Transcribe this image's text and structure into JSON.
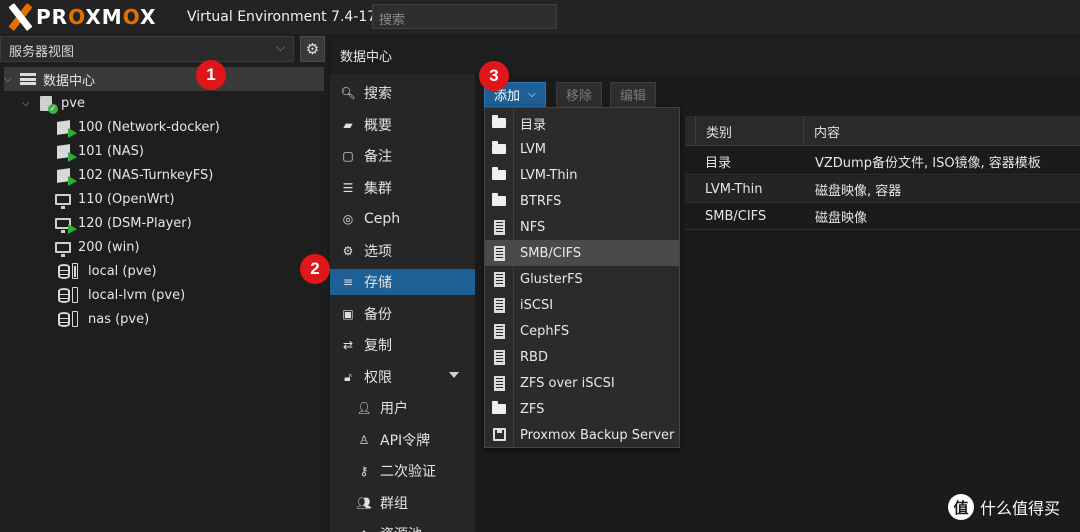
{
  "header": {
    "logo_text_a": "PR",
    "logo_text_o1": "O",
    "logo_text_b": "XM",
    "logo_text_o2": "O",
    "logo_text_c": "X",
    "version": "Virtual Environment 7.4-17",
    "search_placeholder": "搜索"
  },
  "left_panel": {
    "view_select": "服务器视图",
    "tree": [
      {
        "label": "数据中心",
        "icon": "server-stack-icon"
      },
      {
        "label": "pve",
        "icon": "node-icon"
      },
      {
        "label": "100 (Network-docker)",
        "icon": "container-icon"
      },
      {
        "label": "101 (NAS)",
        "icon": "container-icon"
      },
      {
        "label": "102 (NAS-TurnkeyFS)",
        "icon": "container-icon"
      },
      {
        "label": "110 (OpenWrt)",
        "icon": "vm-icon"
      },
      {
        "label": "120 (DSM-Player)",
        "icon": "vm-icon"
      },
      {
        "label": "200 (win)",
        "icon": "vm-icon"
      },
      {
        "label": "local (pve)",
        "icon": "storage-icon"
      },
      {
        "label": "local-lvm (pve)",
        "icon": "storage-icon"
      },
      {
        "label": "nas (pve)",
        "icon": "storage-icon"
      }
    ]
  },
  "right_panel": {
    "title": "数据中心",
    "nav": [
      {
        "label": "搜索",
        "icon": "search-icon"
      },
      {
        "label": "概要",
        "icon": "book-icon"
      },
      {
        "label": "备注",
        "icon": "note-icon"
      },
      {
        "label": "集群",
        "icon": "cluster-icon"
      },
      {
        "label": "Ceph",
        "icon": "ceph-icon"
      },
      {
        "label": "选项",
        "icon": "gear-icon"
      },
      {
        "label": "存储",
        "icon": "database-icon"
      },
      {
        "label": "备份",
        "icon": "save-icon"
      },
      {
        "label": "复制",
        "icon": "retweet-icon"
      },
      {
        "label": "权限",
        "icon": "unlock-icon"
      },
      {
        "label": "用户",
        "icon": "user-icon"
      },
      {
        "label": "API令牌",
        "icon": "user-outline-icon"
      },
      {
        "label": "二次验证",
        "icon": "key-icon"
      },
      {
        "label": "群组",
        "icon": "users-icon"
      },
      {
        "label": "资源池",
        "icon": "pool-icon"
      }
    ],
    "toolbar": {
      "add": "添加",
      "remove": "移除",
      "edit": "编辑"
    },
    "grid": {
      "columns": [
        "类别",
        "内容"
      ],
      "rows": [
        {
          "type": "目录",
          "content": "VZDump备份文件, ISO镜像, 容器模板"
        },
        {
          "type": "LVM-Thin",
          "content": "磁盘映像, 容器"
        },
        {
          "type": "SMB/CIFS",
          "content": "磁盘映像"
        }
      ]
    }
  },
  "add_menu": {
    "items": [
      {
        "label": "目录",
        "icon": "folder-icon"
      },
      {
        "label": "LVM",
        "icon": "folder-icon"
      },
      {
        "label": "LVM-Thin",
        "icon": "folder-icon"
      },
      {
        "label": "BTRFS",
        "icon": "folder-icon"
      },
      {
        "label": "NFS",
        "icon": "building-icon"
      },
      {
        "label": "SMB/CIFS",
        "icon": "building-icon"
      },
      {
        "label": "GlusterFS",
        "icon": "building-icon"
      },
      {
        "label": "iSCSI",
        "icon": "building-icon"
      },
      {
        "label": "CephFS",
        "icon": "building-icon"
      },
      {
        "label": "RBD",
        "icon": "building-icon"
      },
      {
        "label": "ZFS over iSCSI",
        "icon": "building-icon"
      },
      {
        "label": "ZFS",
        "icon": "folder-icon"
      },
      {
        "label": "Proxmox Backup Server",
        "icon": "save-icon"
      }
    ],
    "highlighted": "SMB/CIFS"
  },
  "markers": [
    "1",
    "2",
    "3"
  ],
  "watermark": {
    "glyph": "值",
    "text": "什么值得买"
  },
  "colors": {
    "accent_blue": "#1e5f95",
    "logo_orange": "#e57000",
    "marker_red": "#e0161a"
  }
}
